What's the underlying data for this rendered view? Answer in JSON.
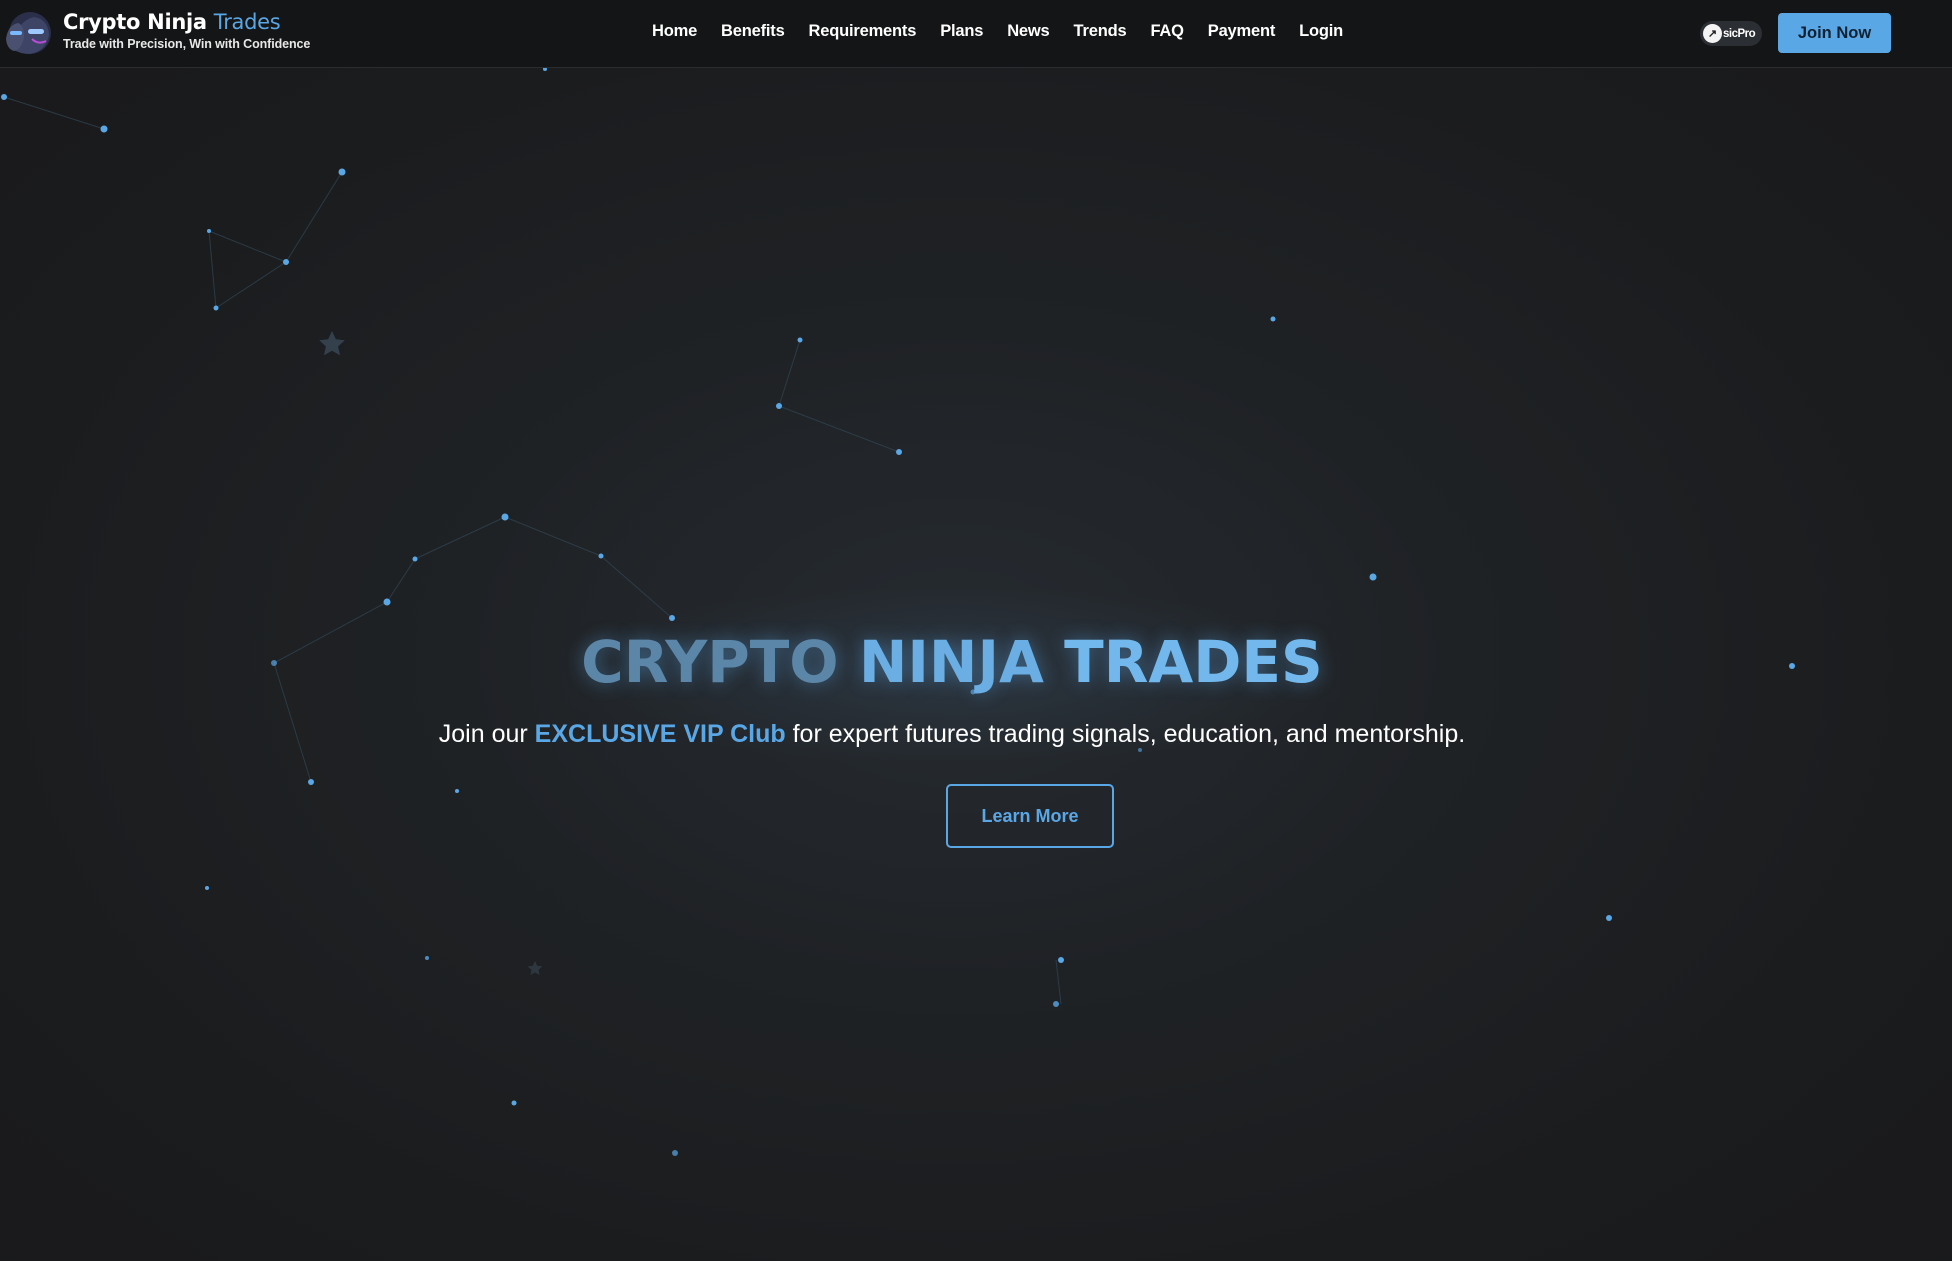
{
  "brand": {
    "title_main": "Crypto Ninja",
    "title_accent": "Trades",
    "tagline": "Trade with Precision, Win with Confidence",
    "logo_icon": "ninja-mascot-icon"
  },
  "nav": {
    "items": [
      "Home",
      "Benefits",
      "Requirements",
      "Plans",
      "News",
      "Trends",
      "FAQ",
      "Payment",
      "Login"
    ]
  },
  "header_right": {
    "pro_badge_label": "sicPro",
    "pro_badge_icon": "pro-logo-icon",
    "join_label": "Join Now"
  },
  "hero": {
    "title_words": [
      "CRYPTO",
      "NINJA",
      "TRADES"
    ],
    "subtitle_before": "Join our ",
    "subtitle_highlight": "EXCLUSIVE VIP Club",
    "subtitle_after": " for expert futures trading signals, education, and mentorship.",
    "cta_label": "Learn More"
  },
  "colors": {
    "background": "#1c1d1f",
    "header": "#141516",
    "accent": "#5aa7e6",
    "text": "#ffffff",
    "node": "#5aa7e6"
  }
}
